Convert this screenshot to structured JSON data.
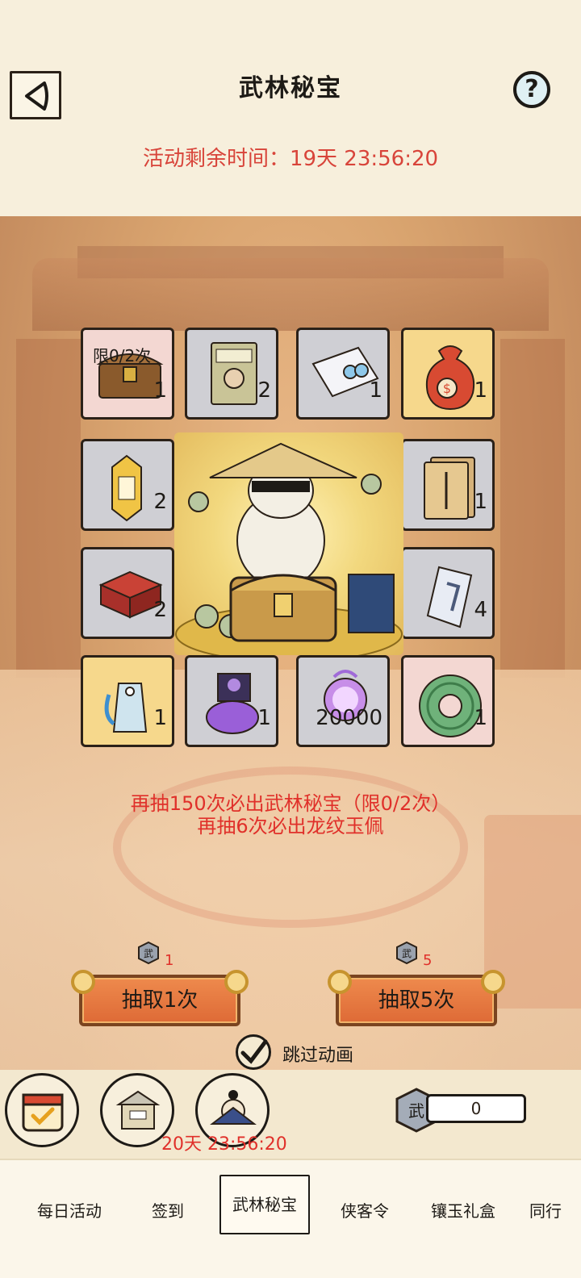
{
  "header": {
    "title": "武林秘宝",
    "help_label": "?",
    "timer": "活动剩余时间：19天 23:56:20"
  },
  "grid": {
    "items": [
      {
        "name": "treasure-chest",
        "qty": "1",
        "limit": "限0/2次",
        "style": "red"
      },
      {
        "name": "manual-book",
        "qty": "2",
        "style": "grey"
      },
      {
        "name": "letter-with-pearls",
        "qty": "1",
        "style": "grey"
      },
      {
        "name": "money-bag",
        "qty": "1",
        "style": "gold"
      },
      {
        "name": "gold-token",
        "qty": "2",
        "style": "grey"
      },
      {
        "name": "hire-voucher",
        "qty": "1",
        "style": "grey"
      },
      {
        "name": "red-jewel-box",
        "qty": "2",
        "style": "grey"
      },
      {
        "name": "blade-scroll",
        "qty": "4",
        "style": "grey"
      },
      {
        "name": "jade-tag",
        "qty": "1",
        "style": "gold"
      },
      {
        "name": "poison-bag",
        "qty": "1",
        "style": "grey"
      },
      {
        "name": "spirit-orb",
        "qty": "20000",
        "style": "grey"
      },
      {
        "name": "dragon-jade-pendant",
        "qty": "1",
        "style": "red"
      }
    ]
  },
  "notes": {
    "line1": "再抽150次必出武林秘宝（限0/2次）",
    "line2": "再抽6次必出龙纹玉佩"
  },
  "draw": {
    "one": {
      "label": "抽取1次",
      "cost": "1"
    },
    "five": {
      "label": "抽取5次",
      "cost": "5"
    }
  },
  "skip_animation": {
    "label": "跳过动画",
    "checked": true
  },
  "bottom": {
    "event_timer": "20天 23:56:20",
    "currency_value": "0",
    "currency_glyph": "武"
  },
  "tabs": [
    "每日活动",
    "签到",
    "武林秘宝",
    "侠客令",
    "镶玉礼盒",
    "同行"
  ],
  "active_tab": "武林秘宝",
  "colors": {
    "accent_red": "#e0302a",
    "button_orange": "#de6a36",
    "cell_grey": "#cfcfd4",
    "cell_gold": "#f6d88c"
  }
}
